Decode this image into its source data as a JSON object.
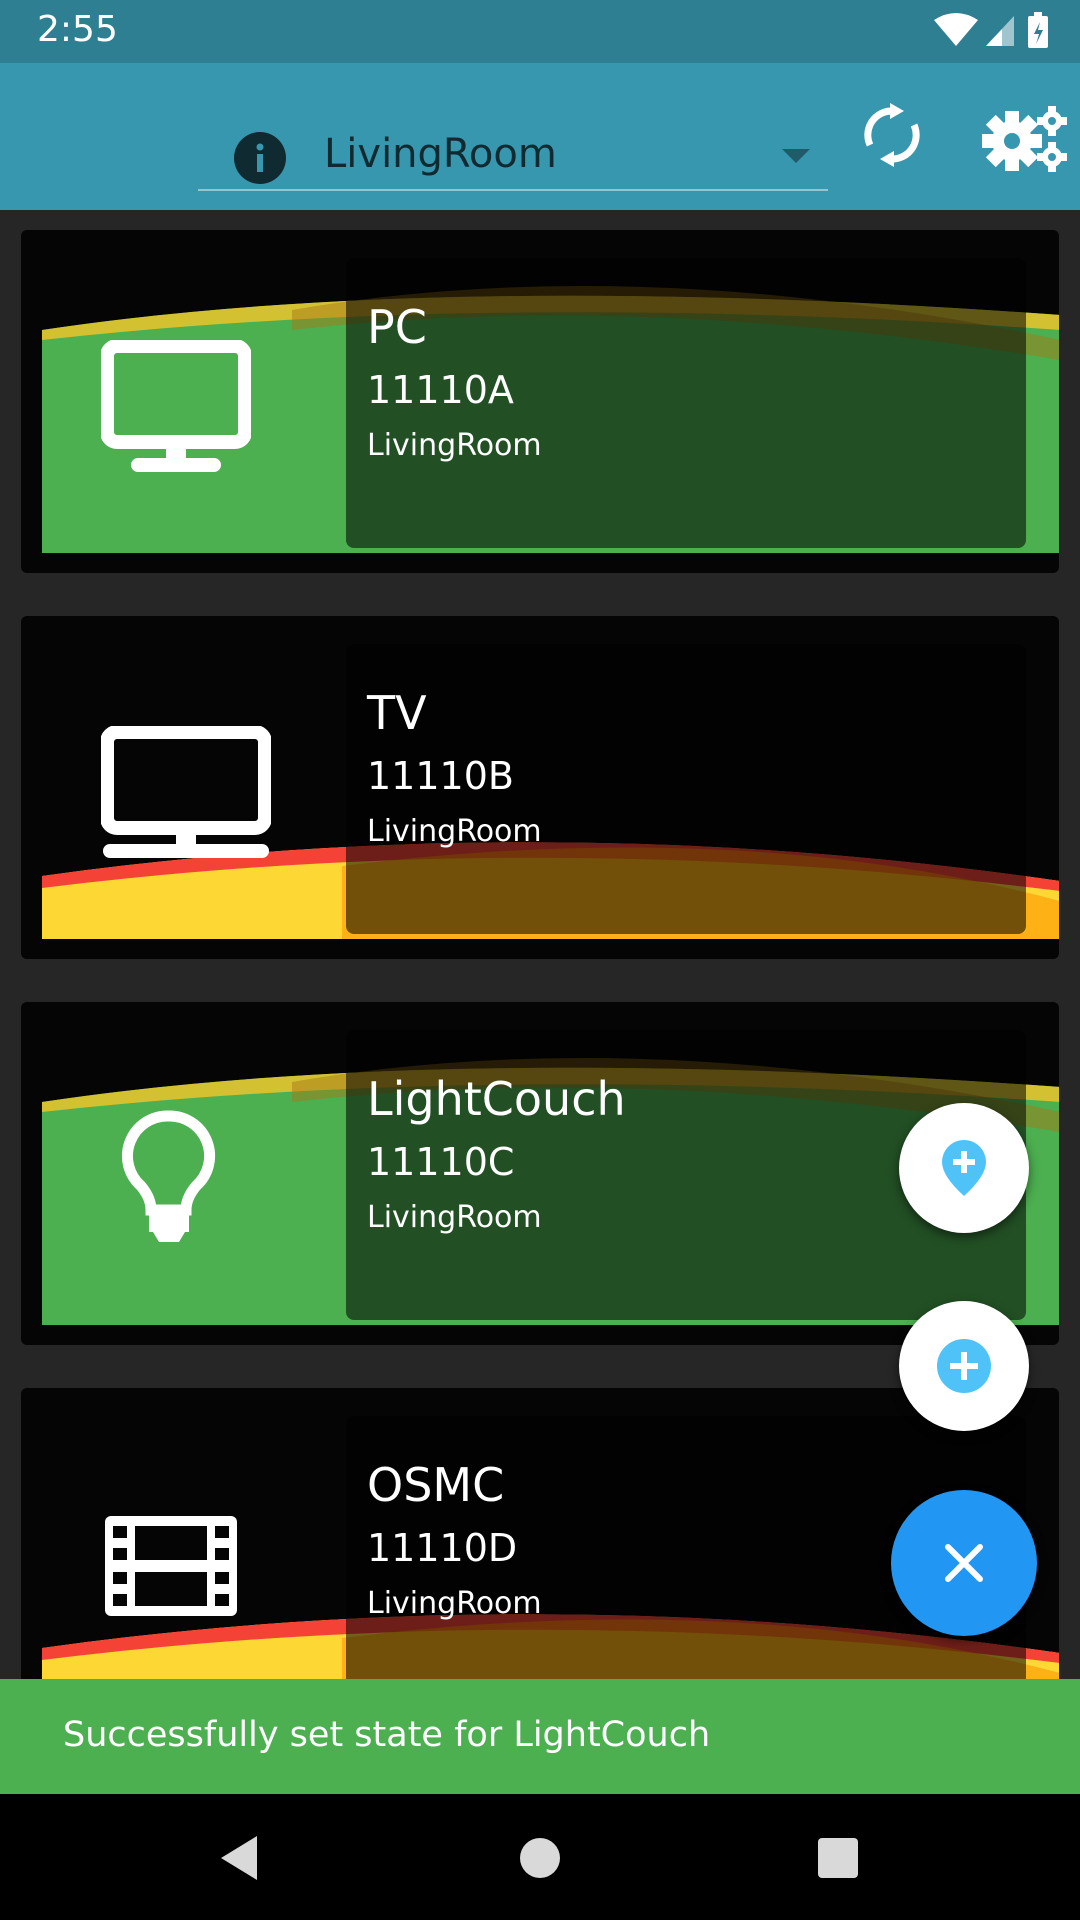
{
  "status_bar": {
    "time": "2:55"
  },
  "header": {
    "selected_room": "LivingRoom"
  },
  "devices": [
    {
      "name": "PC",
      "code": "11110A",
      "room": "LivingRoom",
      "icon": "monitor-icon",
      "state": "on"
    },
    {
      "name": "TV",
      "code": "11110B",
      "room": "LivingRoom",
      "icon": "monitor-icon",
      "state": "off"
    },
    {
      "name": "LightCouch",
      "code": "11110C",
      "room": "LivingRoom",
      "icon": "lightbulb-icon",
      "state": "on"
    },
    {
      "name": "OSMC",
      "code": "11110D",
      "room": "LivingRoom",
      "icon": "film-icon",
      "state": "off"
    }
  ],
  "fab_menu": {
    "add_location_icon": "add-location-icon",
    "add_device_icon": "add-circle-icon",
    "close_icon": "close-icon"
  },
  "snackbar": {
    "message": "Successfully set state for LightCouch"
  },
  "colors": {
    "on": "#4caf50",
    "off": "#fdd835",
    "accent": "#2196f3",
    "app_bar": "#3797ae"
  }
}
